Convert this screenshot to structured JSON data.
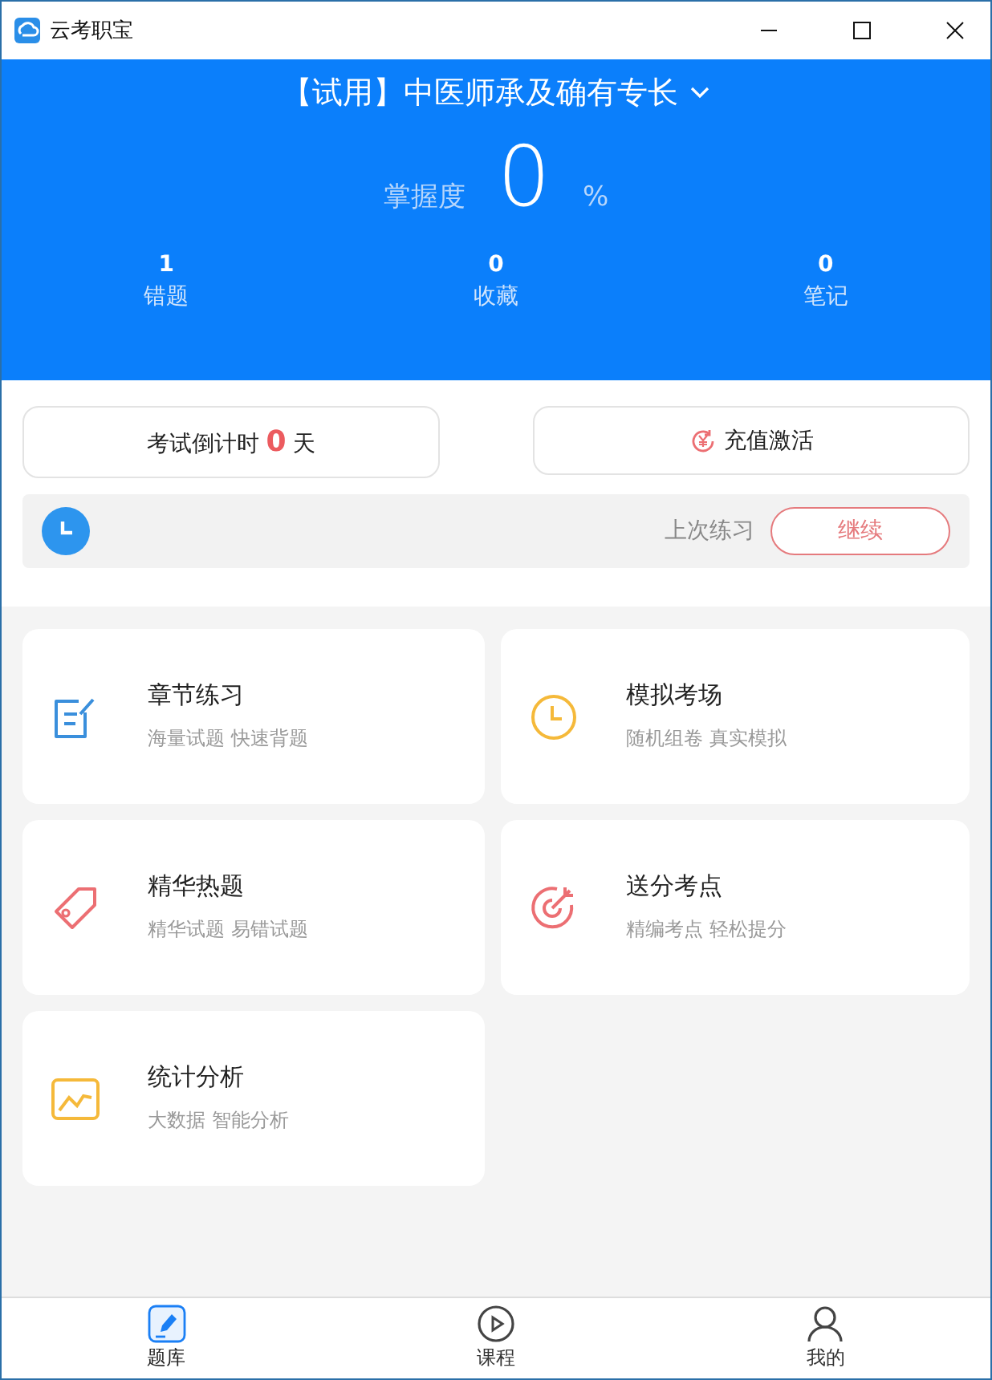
{
  "window": {
    "title": "云考职宝"
  },
  "header": {
    "course": "【试用】中医师承及确有专长",
    "mastery_label": "掌握度",
    "mastery_value": "0",
    "mastery_unit": "%"
  },
  "stats": [
    {
      "value": "1",
      "label": "错题"
    },
    {
      "value": "0",
      "label": "收藏"
    },
    {
      "value": "0",
      "label": "笔记"
    }
  ],
  "countdown": {
    "prefix": "考试倒计时",
    "days": "0",
    "suffix": "天"
  },
  "recharge": {
    "label": "充值激活"
  },
  "last_practice": {
    "text": "上次练习",
    "button": "继续"
  },
  "cards": [
    {
      "kind": "note",
      "title": "章节练习",
      "subtitle": "海量试题 快速背题"
    },
    {
      "kind": "clock",
      "title": "模拟考场",
      "subtitle": "随机组卷 真实模拟"
    },
    {
      "kind": "tag",
      "title": "精华热题",
      "subtitle": "精华试题 易错试题"
    },
    {
      "kind": "target",
      "title": "送分考点",
      "subtitle": "精编考点 轻松提分"
    },
    {
      "kind": "chart",
      "title": "统计分析",
      "subtitle": "大数据 智能分析"
    }
  ],
  "nav": [
    {
      "kind": "pen",
      "label": "题库",
      "selected": true
    },
    {
      "kind": "play",
      "label": "课程",
      "selected": false
    },
    {
      "kind": "person",
      "label": "我的",
      "selected": false
    }
  ]
}
